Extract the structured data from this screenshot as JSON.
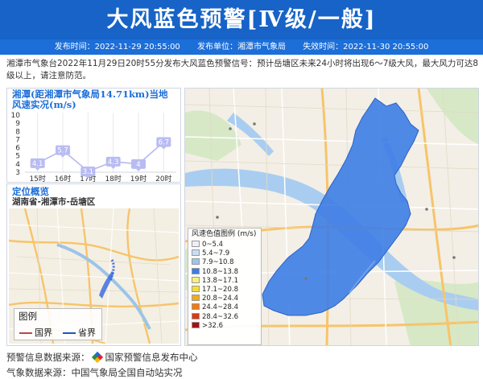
{
  "header": {
    "title": "大风蓝色预警[Ⅳ级/一般]",
    "publish_time": "发布时间：2022-11-29 20:55:00",
    "publisher": "发布单位：湘潭市气象局",
    "expire_time": "失效时间：2022-11-30 20:55:00"
  },
  "description": "湘潭市气象台2022年11月29日20时55分发布大风蓝色预警信号：预计岳塘区未来24小时将出现6～7级大风，最大风力可达8级以上，请注意防范。",
  "chart_panel": {
    "title": "湘潭(距湘潭市气象局14.71km)当地风速实况(m/s)"
  },
  "chart_data": {
    "type": "line",
    "title": "湘潭(距湘潭市气象局14.71km)当地风速实况(m/s)",
    "categories": [
      "15时",
      "16时",
      "17时",
      "18时",
      "19时",
      "20时"
    ],
    "values": [
      4.1,
      5.7,
      3.1,
      4.3,
      4.0,
      6.7
    ],
    "value_labels": [
      "4.1",
      "5.7",
      "3.1",
      "4.3",
      "4",
      "6.7"
    ],
    "y_ticks": [
      "3",
      "4",
      "5",
      "6",
      "7",
      "8",
      "9",
      "10"
    ],
    "ylim": [
      3,
      10
    ],
    "grid": true,
    "colors": {
      "line": "#b5b9ef",
      "label_bg": "#b9bcf2",
      "marker": "#8c93e6"
    }
  },
  "location": {
    "title": "定位概览",
    "path": "湖南省-湘潭市-岳塘区",
    "legend_title": "图例",
    "legend_items": [
      {
        "label": "国界",
        "color": "#c0424e"
      },
      {
        "label": "省界",
        "color": "#1c56c8"
      }
    ]
  },
  "scale_legend": {
    "title": "风速色值图例 (m/s)",
    "items": [
      {
        "label": "0~5.4",
        "color": "#eef0f8"
      },
      {
        "label": "5.4~7.9",
        "color": "#c9dcf5"
      },
      {
        "label": "7.9~10.8",
        "color": "#9ec3ef"
      },
      {
        "label": "10.8~13.8",
        "color": "#3d7de6"
      },
      {
        "label": "13.8~17.1",
        "color": "#f6f07a"
      },
      {
        "label": "17.1~20.8",
        "color": "#f5dd38"
      },
      {
        "label": "20.8~24.4",
        "color": "#f5aa18"
      },
      {
        "label": "24.4~28.4",
        "color": "#f07a14"
      },
      {
        "label": "28.4~32.6",
        "color": "#d83a12"
      },
      {
        "label": ">32.6",
        "color": "#a51212"
      }
    ]
  },
  "footer": {
    "warning_source_label": "预警信息数据来源：",
    "warning_source": "国家预警信息发布中心",
    "weather_source_label": "气象数据来源：",
    "weather_source": "中国气象局全国自动站实况"
  },
  "colors": {
    "banner": "#1763c7",
    "meta_bar": "#1c6ed8",
    "accent": "#1c6ed8",
    "alert_area": "#3d7de6"
  }
}
